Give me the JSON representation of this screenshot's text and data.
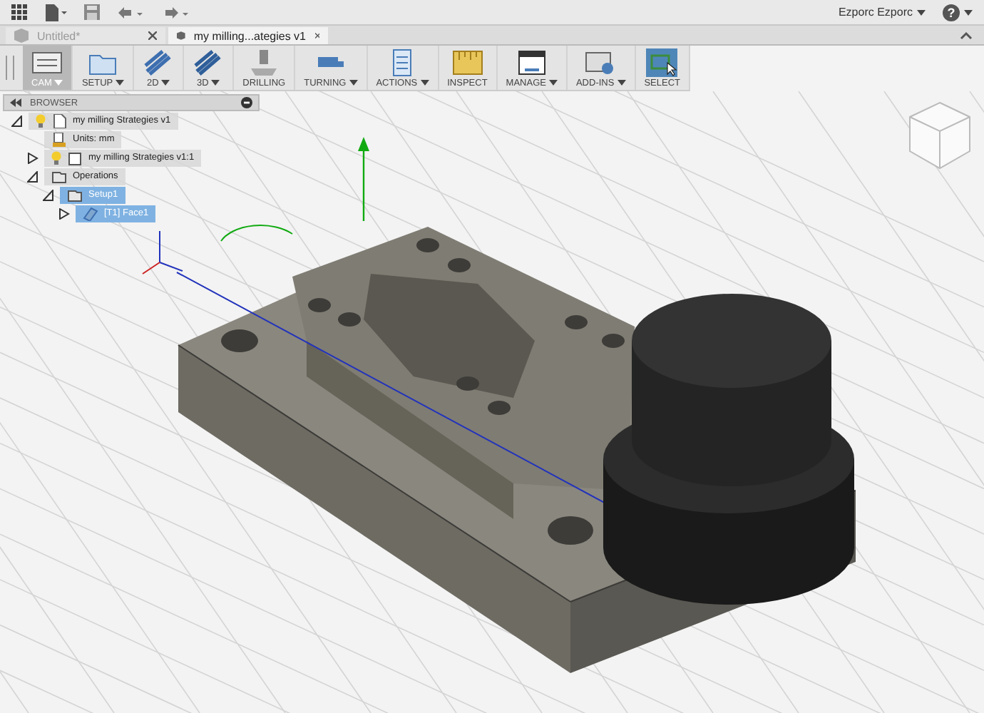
{
  "user": {
    "name": "Ezporc Ezporc"
  },
  "help": {
    "glyph": "?"
  },
  "tabs": [
    {
      "label": "Untitled*",
      "selected": false
    },
    {
      "label": "my milling...ategies v1",
      "selected": true
    }
  ],
  "toolbar": [
    {
      "label": "CAM",
      "kind": "cam",
      "dropdown": true,
      "selected": true
    },
    {
      "label": "SETUP",
      "kind": "setup",
      "dropdown": true,
      "selected": false
    },
    {
      "label": "2D",
      "kind": "flat",
      "dropdown": true,
      "selected": false
    },
    {
      "label": "3D",
      "kind": "solid",
      "dropdown": true,
      "selected": false
    },
    {
      "label": "DRILLING",
      "kind": "drill",
      "dropdown": false,
      "selected": false
    },
    {
      "label": "TURNING",
      "kind": "turn",
      "dropdown": true,
      "selected": false
    },
    {
      "label": "ACTIONS",
      "kind": "actions",
      "dropdown": true,
      "selected": false
    },
    {
      "label": "INSPECT",
      "kind": "inspect",
      "dropdown": false,
      "selected": false
    },
    {
      "label": "MANAGE",
      "kind": "manage",
      "dropdown": true,
      "selected": false
    },
    {
      "label": "ADD-INS",
      "kind": "addins",
      "dropdown": true,
      "selected": false
    },
    {
      "label": "SELECT",
      "kind": "select",
      "dropdown": false,
      "selected": false
    }
  ],
  "browser": {
    "title": "BROWSER",
    "items": [
      {
        "label": "my milling Strategies v1",
        "kind": "document",
        "light": true,
        "expanded": true,
        "selected": false,
        "children": [
          {
            "label": "Units: mm",
            "kind": "units",
            "light": false,
            "selected": false
          },
          {
            "label": "my milling Strategies v1:1",
            "kind": "component",
            "light": true,
            "expanded": false,
            "selected": false
          },
          {
            "label": "Operations",
            "kind": "operations",
            "light": false,
            "expanded": true,
            "selected": false,
            "children": [
              {
                "label": "Setup1",
                "kind": "setup",
                "light": false,
                "expanded": true,
                "selected": true,
                "children": [
                  {
                    "label": "[T1] Face1",
                    "kind": "face",
                    "light": false,
                    "expanded": false,
                    "selected": true
                  }
                ]
              }
            ]
          }
        ]
      }
    ]
  }
}
